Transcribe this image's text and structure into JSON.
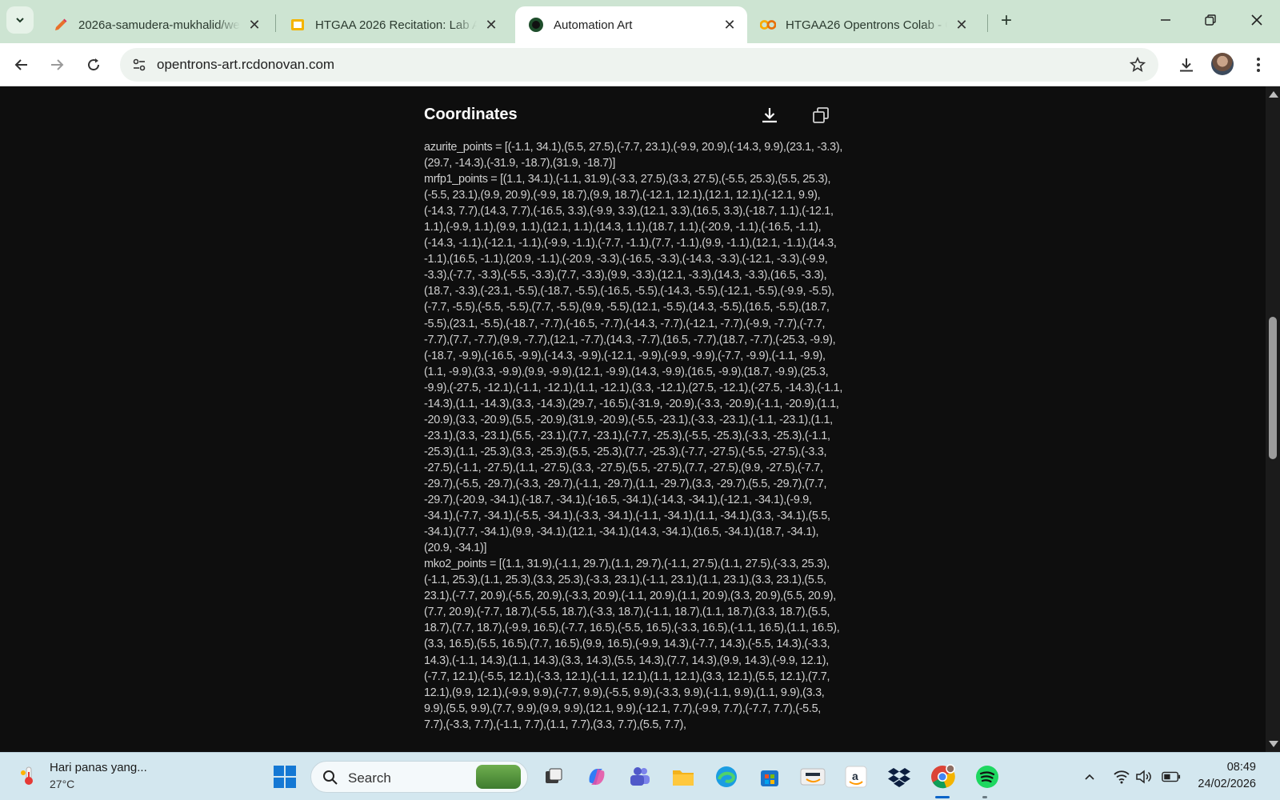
{
  "browser": {
    "tabs": [
      {
        "title": "2026a-samudera-mukhalid/wel",
        "favicon": "pencil-icon",
        "active": false
      },
      {
        "title": "HTGAA 2026 Recitation: Lab Au",
        "favicon": "slides-icon",
        "active": false
      },
      {
        "title": "Automation Art",
        "favicon": "site-icon",
        "active": true
      },
      {
        "title": "HTGAA26 Opentrons Colab - Co",
        "favicon": "colab-icon",
        "active": false
      }
    ],
    "url": "opentrons-art.rcdonovan.com"
  },
  "panel": {
    "title": "Coordinates",
    "download_tooltip": "download-icon",
    "copy_tooltip": "copy-icon",
    "lines": [
      "azurite_points = [(-1.1, 34.1),(5.5, 27.5),(-7.7, 23.1),(-9.9, 20.9),(-14.3, 9.9),(23.1, -3.3),(29.7, -14.3),(-31.9, -18.7),(31.9, -18.7)]",
      "mrfp1_points = [(1.1, 34.1),(-1.1, 31.9),(-3.3, 27.5),(3.3, 27.5),(-5.5, 25.3),(5.5, 25.3),(-5.5, 23.1),(9.9, 20.9),(-9.9, 18.7),(9.9, 18.7),(-12.1, 12.1),(12.1, 12.1),(-12.1, 9.9),(-14.3, 7.7),(14.3, 7.7),(-16.5, 3.3),(-9.9, 3.3),(12.1, 3.3),(16.5, 3.3),(-18.7, 1.1),(-12.1, 1.1),(-9.9, 1.1),(9.9, 1.1),(12.1, 1.1),(14.3, 1.1),(18.7, 1.1),(-20.9, -1.1),(-16.5, -1.1),(-14.3, -1.1),(-12.1, -1.1),(-9.9, -1.1),(-7.7, -1.1),(7.7, -1.1),(9.9, -1.1),(12.1, -1.1),(14.3, -1.1),(16.5, -1.1),(20.9, -1.1),(-20.9, -3.3),(-16.5, -3.3),(-14.3, -3.3),(-12.1, -3.3),(-9.9, -3.3),(-7.7, -3.3),(-5.5, -3.3),(7.7, -3.3),(9.9, -3.3),(12.1, -3.3),(14.3, -3.3),(16.5, -3.3),(18.7, -3.3),(-23.1, -5.5),(-18.7, -5.5),(-16.5, -5.5),(-14.3, -5.5),(-12.1, -5.5),(-9.9, -5.5),(-7.7, -5.5),(-5.5, -5.5),(7.7, -5.5),(9.9, -5.5),(12.1, -5.5),(14.3, -5.5),(16.5, -5.5),(18.7, -5.5),(23.1, -5.5),(-18.7, -7.7),(-16.5, -7.7),(-14.3, -7.7),(-12.1, -7.7),(-9.9, -7.7),(-7.7, -7.7),(7.7, -7.7),(9.9, -7.7),(12.1, -7.7),(14.3, -7.7),(16.5, -7.7),(18.7, -7.7),(-25.3, -9.9),(-18.7, -9.9),(-16.5, -9.9),(-14.3, -9.9),(-12.1, -9.9),(-9.9, -9.9),(-7.7, -9.9),(-1.1, -9.9),(1.1, -9.9),(3.3, -9.9),(9.9, -9.9),(12.1, -9.9),(14.3, -9.9),(16.5, -9.9),(18.7, -9.9),(25.3, -9.9),(-27.5, -12.1),(-1.1, -12.1),(1.1, -12.1),(3.3, -12.1),(27.5, -12.1),(-27.5, -14.3),(-1.1, -14.3),(1.1, -14.3),(3.3, -14.3),(29.7, -16.5),(-31.9, -20.9),(-3.3, -20.9),(-1.1, -20.9),(1.1, -20.9),(3.3, -20.9),(5.5, -20.9),(31.9, -20.9),(-5.5, -23.1),(-3.3, -23.1),(-1.1, -23.1),(1.1, -23.1),(3.3, -23.1),(5.5, -23.1),(7.7, -23.1),(-7.7, -25.3),(-5.5, -25.3),(-3.3, -25.3),(-1.1, -25.3),(1.1, -25.3),(3.3, -25.3),(5.5, -25.3),(7.7, -25.3),(-7.7, -27.5),(-5.5, -27.5),(-3.3, -27.5),(-1.1, -27.5),(1.1, -27.5),(3.3, -27.5),(5.5, -27.5),(7.7, -27.5),(9.9, -27.5),(-7.7, -29.7),(-5.5, -29.7),(-3.3, -29.7),(-1.1, -29.7),(1.1, -29.7),(3.3, -29.7),(5.5, -29.7),(7.7, -29.7),(-20.9, -34.1),(-18.7, -34.1),(-16.5, -34.1),(-14.3, -34.1),(-12.1, -34.1),(-9.9, -34.1),(-7.7, -34.1),(-5.5, -34.1),(-3.3, -34.1),(-1.1, -34.1),(1.1, -34.1),(3.3, -34.1),(5.5, -34.1),(7.7, -34.1),(9.9, -34.1),(12.1, -34.1),(14.3, -34.1),(16.5, -34.1),(18.7, -34.1),(20.9, -34.1)]",
      "mko2_points = [(1.1, 31.9),(-1.1, 29.7),(1.1, 29.7),(-1.1, 27.5),(1.1, 27.5),(-3.3, 25.3),(-1.1, 25.3),(1.1, 25.3),(3.3, 25.3),(-3.3, 23.1),(-1.1, 23.1),(1.1, 23.1),(3.3, 23.1),(5.5, 23.1),(-7.7, 20.9),(-5.5, 20.9),(-3.3, 20.9),(-1.1, 20.9),(1.1, 20.9),(3.3, 20.9),(5.5, 20.9),(7.7, 20.9),(-7.7, 18.7),(-5.5, 18.7),(-3.3, 18.7),(-1.1, 18.7),(1.1, 18.7),(3.3, 18.7),(5.5, 18.7),(7.7, 18.7),(-9.9, 16.5),(-7.7, 16.5),(-5.5, 16.5),(-3.3, 16.5),(-1.1, 16.5),(1.1, 16.5),(3.3, 16.5),(5.5, 16.5),(7.7, 16.5),(9.9, 16.5),(-9.9, 14.3),(-7.7, 14.3),(-5.5, 14.3),(-3.3, 14.3),(-1.1, 14.3),(1.1, 14.3),(3.3, 14.3),(5.5, 14.3),(7.7, 14.3),(9.9, 14.3),(-9.9, 12.1),(-7.7, 12.1),(-5.5, 12.1),(-3.3, 12.1),(-1.1, 12.1),(1.1, 12.1),(3.3, 12.1),(5.5, 12.1),(7.7, 12.1),(9.9, 12.1),(-9.9, 9.9),(-7.7, 9.9),(-5.5, 9.9),(-3.3, 9.9),(-1.1, 9.9),(1.1, 9.9),(3.3, 9.9),(5.5, 9.9),(7.7, 9.9),(9.9, 9.9),(12.1, 9.9),(-12.1, 7.7),(-9.9, 7.7),(-7.7, 7.7),(-5.5, 7.7),(-3.3, 7.7),(-1.1, 7.7),(1.1, 7.7),(3.3, 7.7),(5.5, 7.7),"
    ]
  },
  "taskbar": {
    "weather_title": "Hari panas yang...",
    "weather_temp": "27°C",
    "search_label": "Search",
    "time": "08:49",
    "date": "24/02/2026"
  },
  "colors": {
    "tabstrip": "#cde4d2",
    "page_background": "#0e0e0e",
    "text": "#d0d0d0",
    "taskbar": "#d3e7ef"
  }
}
